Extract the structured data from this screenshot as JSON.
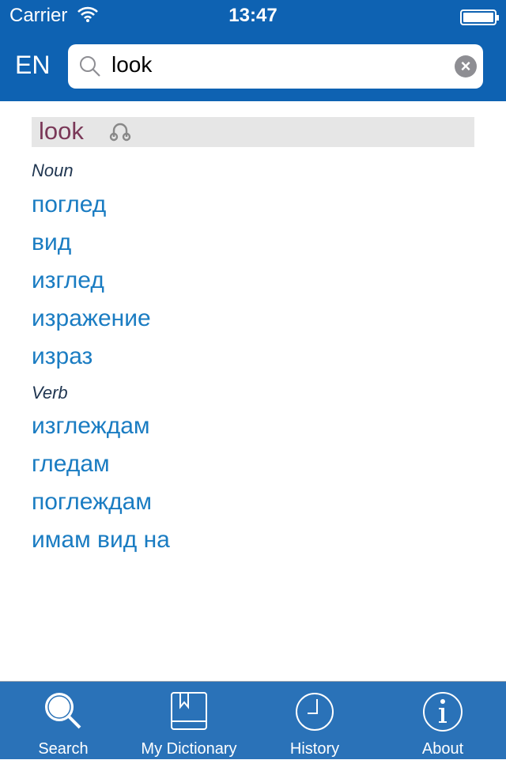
{
  "status_bar": {
    "carrier": "Carrier",
    "time": "13:47"
  },
  "header": {
    "language": "EN",
    "search_value": "look"
  },
  "entry": {
    "headword": "look",
    "sections": [
      {
        "pos": "Noun",
        "translations": [
          "поглед",
          "вид",
          "изглед",
          "изражение",
          "израз"
        ]
      },
      {
        "pos": "Verb",
        "translations": [
          "изглеждам",
          "гледам",
          "поглеждам",
          "имам вид на"
        ]
      }
    ]
  },
  "tabs": [
    {
      "label": "Search",
      "icon": "search-icon",
      "selected": true
    },
    {
      "label": "My Dictionary",
      "icon": "book-icon"
    },
    {
      "label": "History",
      "icon": "clock-icon"
    },
    {
      "label": "About",
      "icon": "info-icon"
    }
  ],
  "colors": {
    "header": "#0e62b2",
    "tabbar": "#2a72b8",
    "translation": "#1a7cc2",
    "headword": "#7a3858"
  }
}
